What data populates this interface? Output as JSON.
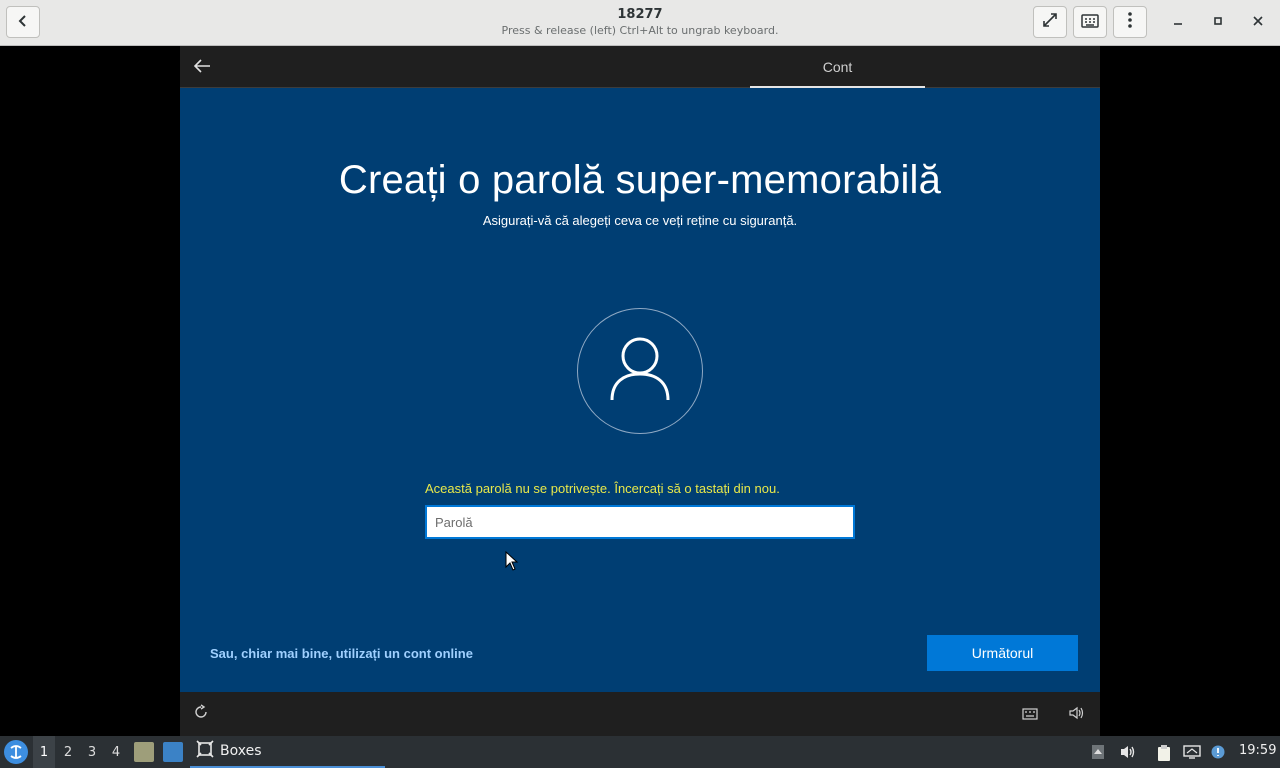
{
  "header": {
    "title": "18277",
    "subtitle": "Press & release (left) Ctrl+Alt to ungrab keyboard.",
    "icons": {
      "back": "chevron-left-icon",
      "fullscreen": "fullscreen-icon",
      "keyboard": "keyboard-icon",
      "menu": "kebab-menu-icon",
      "minimize": "minimize-icon",
      "maximize": "maximize-icon",
      "close": "close-icon"
    }
  },
  "vm": {
    "top_tab": "Cont",
    "title": "Creați o parolă super-memorabilă",
    "subtitle": "Asigurați-vă că alegeți ceva ce veți reține cu siguranță.",
    "error": "Această parolă nu se potrivește. Încercați să o tastați din nou.",
    "password": {
      "value": "",
      "placeholder": "Parolă"
    },
    "online_link": "Sau, chiar mai bine, utilizați un cont online",
    "next_button": "Următorul",
    "colors": {
      "background": "#003e73",
      "accent": "#0078d7",
      "error": "#e8e84a",
      "link": "#9fd0ff"
    }
  },
  "taskbar": {
    "workspaces": [
      "1",
      "2",
      "3",
      "4"
    ],
    "active_workspace": "1",
    "task_label": "Boxes",
    "clock": "19:59"
  }
}
